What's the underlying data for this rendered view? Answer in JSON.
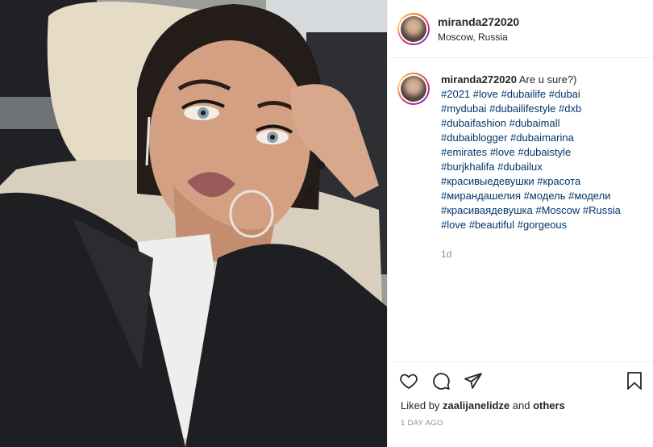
{
  "post": {
    "username": "miranda272020",
    "location": "Moscow, Russia",
    "caption": {
      "username": "miranda272020",
      "text": "Are u sure?)",
      "hashtag_lines": [
        [
          "#2021",
          "#love",
          "#dubailife",
          "#dubai"
        ],
        [
          "#mydubai",
          "#dubailifestyle",
          "#dxb"
        ],
        [
          "#dubaifashion",
          "#dubaimall"
        ],
        [
          "#dubaiblogger",
          "#dubaimarina"
        ],
        [
          "#emirates",
          "#love",
          "#dubaistyle"
        ],
        [
          "#burjkhalifa",
          "#dubailux"
        ],
        [
          "#красивыедевушки",
          "#красота"
        ],
        [
          "#мирандашелия",
          "#модель",
          "#модели"
        ],
        [
          "#красиваядевушка",
          "#Moscow",
          "#Russia"
        ],
        [
          "#love",
          "#beautiful",
          "#gorgeous"
        ]
      ],
      "age": "1d"
    },
    "liked_by_prefix": "Liked by",
    "liked_by_user": "zaalijanelidze",
    "liked_by_and": "and",
    "liked_by_others": "others",
    "date": "1 DAY AGO"
  },
  "colors": {
    "hashtag": "#00376b",
    "muted": "#8e8e8e",
    "divider": "#efefef"
  },
  "icons": [
    "heart-icon",
    "comment-icon",
    "share-icon",
    "bookmark-icon"
  ]
}
